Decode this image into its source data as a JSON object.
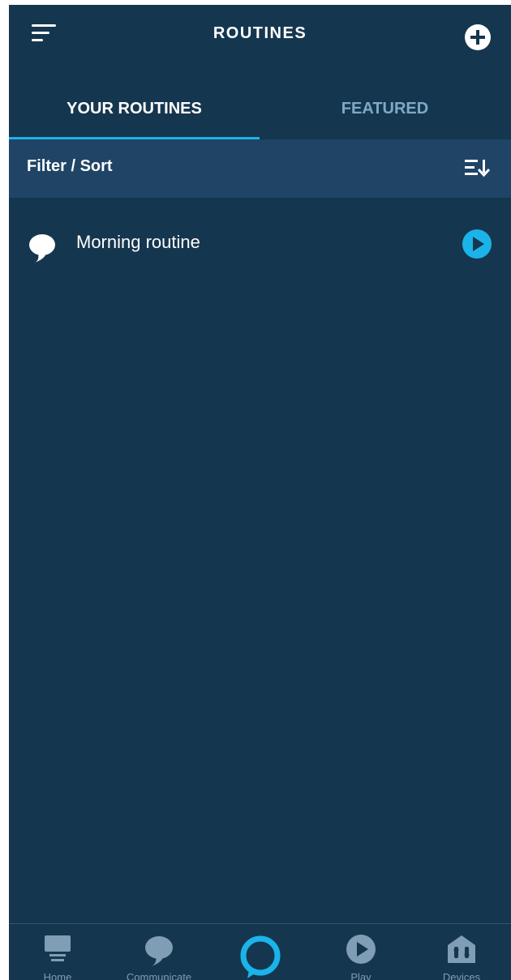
{
  "header": {
    "title": "ROUTINES",
    "menu_icon": "hamburger-menu-icon",
    "add_icon": "add-circle-icon"
  },
  "tabs": [
    {
      "label": "YOUR ROUTINES",
      "active": true
    },
    {
      "label": "FEATURED",
      "active": false
    }
  ],
  "filter": {
    "label": "Filter / Sort",
    "icon": "sort-icon"
  },
  "routines": [
    {
      "name": "Morning routine",
      "icon": "speech-bubble-icon",
      "action_icon": "play-icon"
    }
  ],
  "bottom_nav": [
    {
      "label": "Home",
      "icon": "home-icon"
    },
    {
      "label": "Communicate",
      "icon": "speech-bubble-icon"
    },
    {
      "label": "",
      "icon": "alexa-ring-icon"
    },
    {
      "label": "Play",
      "icon": "play-circle-icon"
    },
    {
      "label": "Devices",
      "icon": "devices-home-icon"
    }
  ],
  "colors": {
    "background": "#15364f",
    "filter_bar": "#1f4466",
    "accent": "#1ab4ea",
    "inactive_tab": "#7fa9c6",
    "nav_text": "#7f9db4"
  }
}
